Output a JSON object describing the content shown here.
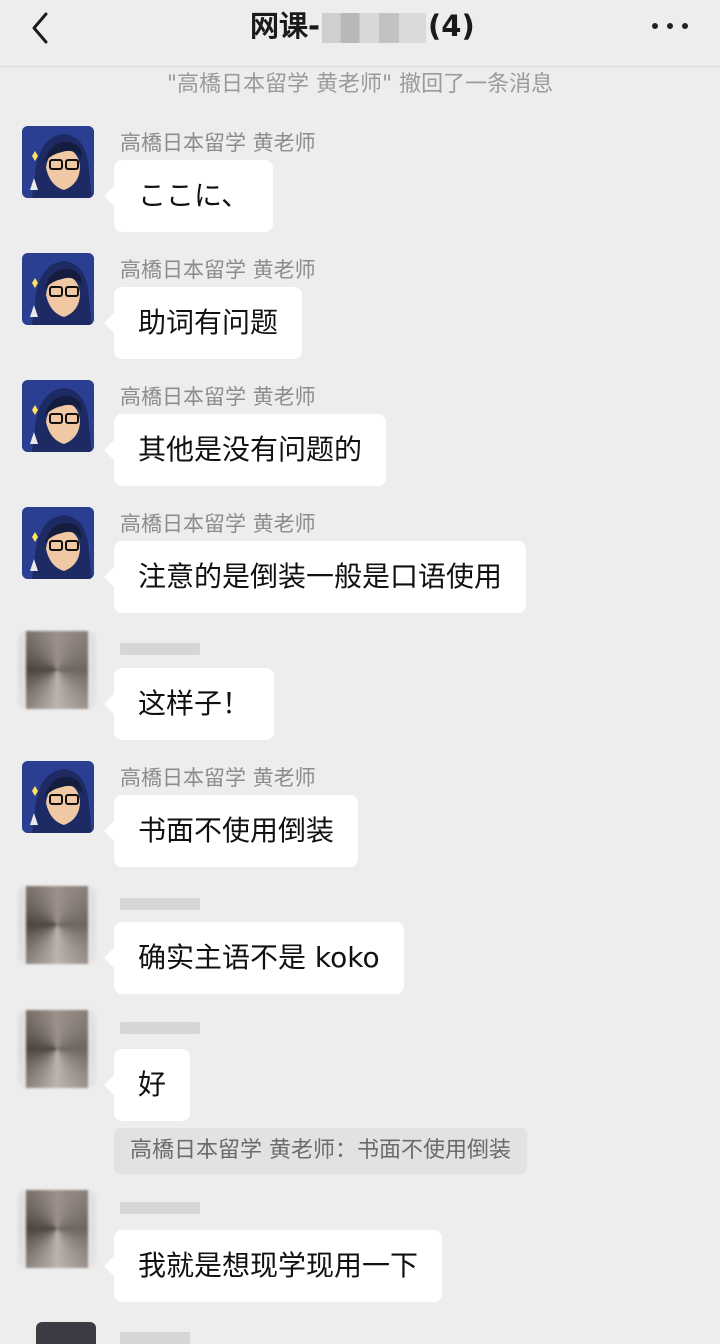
{
  "header": {
    "title_prefix": "网课-",
    "title_suffix": "(4)"
  },
  "system_notice": "\"高橋日本留学 黄老师\" 撤回了一条消息",
  "messages": [
    {
      "sender": "高橋日本留学 黄老师",
      "text": "ここに、"
    },
    {
      "sender": "高橋日本留学 黄老师",
      "text": "助词有问题"
    },
    {
      "sender": "高橋日本留学 黄老师",
      "text": "其他是没有问题的"
    },
    {
      "sender": "高橋日本留学 黄老师",
      "text": "注意的是倒装一般是口语使用"
    },
    {
      "sender": "",
      "text": "这样子！"
    },
    {
      "sender": "高橋日本留学 黄老师",
      "text": "书面不使用倒装"
    },
    {
      "sender": "",
      "text": "确实主语不是 koko"
    },
    {
      "sender": "",
      "text": "好"
    },
    {
      "sender": "",
      "text": "我就是想现学现用一下"
    }
  ],
  "quote": "高橋日本留学 黄老师：书面不使用倒装",
  "icons": {
    "back": "chevron-left-icon",
    "more": "more-icon"
  }
}
